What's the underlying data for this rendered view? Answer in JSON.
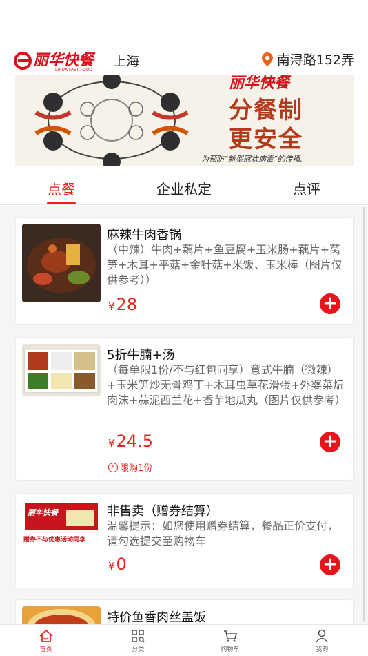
{
  "header": {
    "brand_text": "丽华快餐",
    "brand_sub": "LIHUA FAST FOOD",
    "city": "上海",
    "location": "南浔路152弄",
    "location_icon": "location-pin-icon"
  },
  "banner": {
    "brand_text": "丽华快餐",
    "line1": "分餐制",
    "line2": "更安全",
    "note": "为预防“新型冠状病毒”的传播,"
  },
  "tabs": [
    {
      "label": "点餐",
      "active": true
    },
    {
      "label": "企业私定",
      "active": false
    },
    {
      "label": "点评",
      "active": false
    }
  ],
  "items": [
    {
      "name": "麻辣牛肉香锅",
      "desc": "（中辣）牛肉+藕片+鱼豆腐+玉米肠+藕片+莴笋+木耳+平菇+金针菇+米饭、玉米棒（图片仅供参考））",
      "currency": "¥",
      "price": "28"
    },
    {
      "name": "5折牛腩+汤",
      "desc": "（每单限1份/不与红包同享）意式牛腩（微辣）+玉米笋炒无骨鸡丁+木耳虫草花滑蛋+外婆菜煸肉沫+蒜泥西兰花+香芋地瓜丸（图片仅供参考）",
      "currency": "¥",
      "price": "24.5",
      "limit": "限购1份"
    },
    {
      "name": "非售卖（赠券结算）",
      "desc": "温馨提示：如您使用赠券结算，餐品正价支付，请勾选提交至购物车",
      "currency": "¥",
      "price": "0",
      "thumb_text": "赠券不与优惠活动同享"
    },
    {
      "name": "特价鱼香肉丝盖饭"
    }
  ],
  "tabbar": [
    {
      "label": "首页",
      "icon": "home-icon",
      "active": true
    },
    {
      "label": "分类",
      "icon": "category-icon",
      "active": false
    },
    {
      "label": "购物车",
      "icon": "cart-icon",
      "active": false
    },
    {
      "label": "我的",
      "icon": "profile-icon",
      "active": false
    }
  ],
  "colors": {
    "accent": "#e8241c",
    "banner_text": "#b43a1c"
  }
}
